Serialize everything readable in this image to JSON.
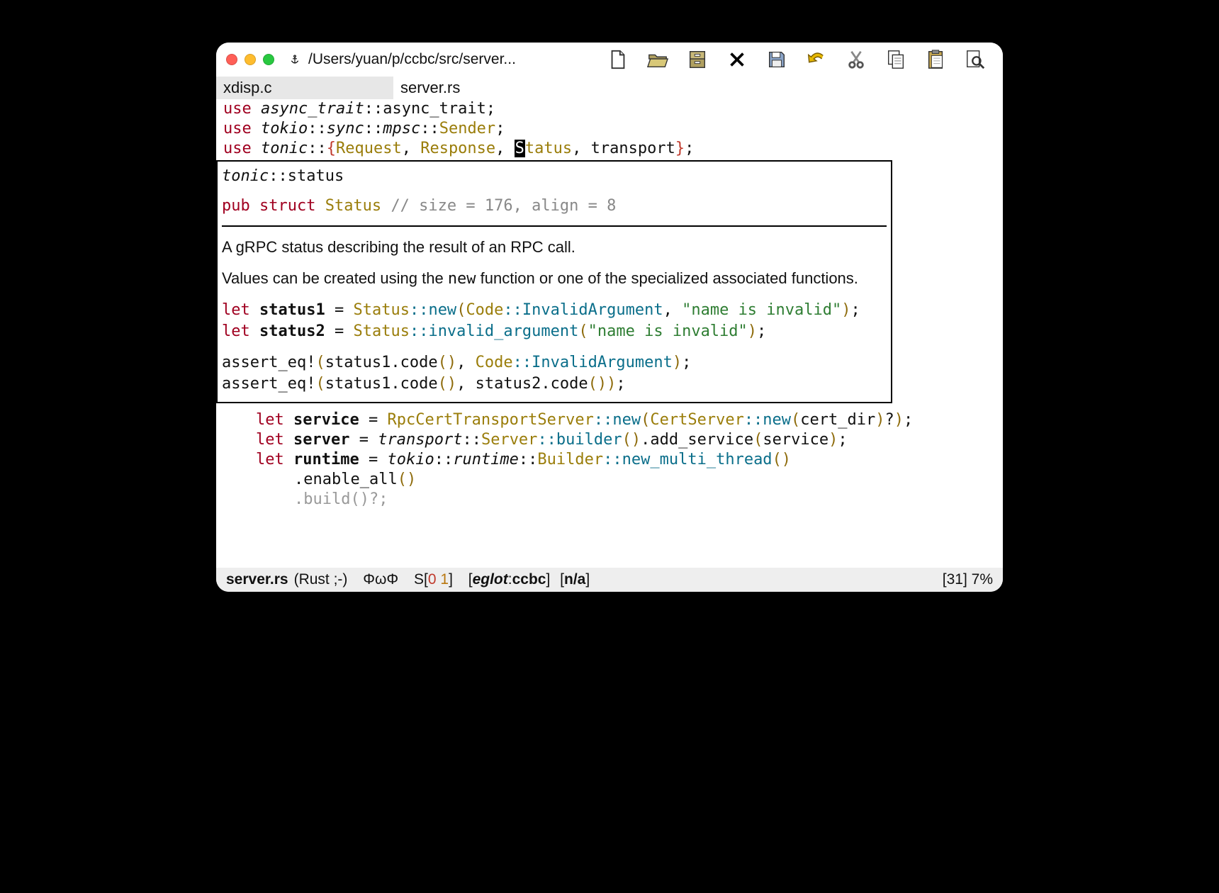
{
  "window": {
    "title": "/Users/yuan/p/ccbc/src/server..."
  },
  "toolbar_icons": [
    "new-file-icon",
    "open-folder-icon",
    "archive-icon",
    "close-icon",
    "save-icon",
    "undo-icon",
    "cut-icon",
    "copy-icon",
    "paste-icon",
    "search-icon"
  ],
  "tabs": {
    "inactive": "xdisp.c",
    "active": "server.rs"
  },
  "code": {
    "l1": {
      "kw": "use",
      "mod": "async_trait",
      "sep": "::",
      "item": "async_trait",
      "end": ";"
    },
    "l2": {
      "kw": "use",
      "mod": "tokio",
      "s1": "::",
      "mod2": "sync",
      "s2": "::",
      "mod3": "mpsc",
      "s3": "::",
      "item": "Sender",
      "end": ";"
    },
    "l3": {
      "kw": "use",
      "mod": "tonic",
      "sep": "::",
      "lb": "{",
      "a": "Request",
      "c1": ", ",
      "b": "Response",
      "c2": ", ",
      "cur": "S",
      "c": "tatus",
      "c3": ", ",
      "d": "transport",
      "rb": "}",
      "end": ";"
    }
  },
  "popup": {
    "path": {
      "mod": "tonic",
      "sep": "::",
      "item": "status"
    },
    "sig": {
      "kw": "pub struct",
      "name": "Status",
      "cmt": "// size = 176, align = 8"
    },
    "doc1": "A gRPC status describing the result of an RPC call.",
    "doc2a": "Values can be created using the ",
    "doc2b": "new",
    "doc2c": " function or one of the specialized associated functions.",
    "ex1": {
      "kw": "let",
      "bold": "status1",
      "eq": " = ",
      "ty": "Status",
      "m": "::new",
      "lp": "(",
      "ty2": "Code",
      "m2": "::InvalidArgument",
      "c": ", ",
      "s": "\"name is invalid\"",
      "rp": ")",
      "end": ";"
    },
    "ex2": {
      "kw": "let",
      "bold": "status2",
      "eq": " = ",
      "ty": "Status",
      "m": "::invalid_argument",
      "lp": "(",
      "s": "\"name is invalid\"",
      "rp": ")",
      "end": ";"
    },
    "ex3": {
      "fn": "assert_eq!",
      "lp": "(",
      "a": "status1.code",
      "lp2": "()",
      "c": ", ",
      "ty": "Code",
      "m": "::InvalidArgument",
      "rp": ")",
      "end": ";"
    },
    "ex4": {
      "fn": "assert_eq!",
      "lp": "(",
      "a": "status1.code",
      "lp2": "()",
      "c": ", ",
      "b": "status2.code",
      "lp3": "()",
      "rp": ")",
      "end": ";"
    }
  },
  "below": {
    "l1": {
      "kw": "let",
      "bold": "service",
      "eq": " = ",
      "ty": "RpcCertTransportServer",
      "m": "::new",
      "lp": "(",
      "ty2": "CertServer",
      "m2": "::new",
      "lp2": "(",
      "arg": "cert_dir",
      "rp2": ")",
      "q": "?",
      "rp": ")",
      "end": ";"
    },
    "l2": {
      "kw": "let",
      "bold": "server",
      "eq": " = ",
      "mod": "transport",
      "s": "::",
      "ty": "Server",
      "m": "::builder",
      "lp": "()",
      "dot": ".",
      "m2": "add_service",
      "lp2": "(",
      "arg": "service",
      "rp2": ")",
      "end": ";"
    },
    "l3": {
      "kw": "let",
      "bold": "runtime",
      "eq": " = ",
      "mod": "tokio",
      "s": "::",
      "mod2": "runtime",
      "s2": "::",
      "ty": "Builder",
      "m": "::new_multi_thread",
      "lp": "()"
    },
    "l4": {
      "dot": ".",
      "m": "enable_all",
      "lp": "()"
    },
    "l5": {
      "txt": ".build()?;"
    }
  },
  "modeline": {
    "file": "server.rs",
    "mode": "(Rust ;-)",
    "sym": "ΦωΦ",
    "s_prefix": "S[",
    "s_err": "0",
    "s_num": " 1",
    "s_suffix": "]",
    "eglot_l": "[",
    "eglot_i": "eglot",
    "eglot_c": ":",
    "eglot_p": "ccbc",
    "eglot_r": "]",
    "na": "[n/a]",
    "pos": "[31] 7%"
  }
}
